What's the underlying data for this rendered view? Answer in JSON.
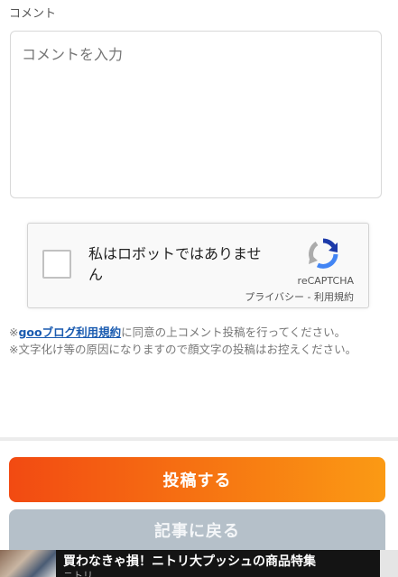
{
  "form": {
    "section_label": "コメント",
    "comment_placeholder": "コメントを入力"
  },
  "recaptcha": {
    "label": "私はロボットではありません",
    "brand": "reCAPTCHA",
    "privacy": "プライバシー",
    "separator": " - ",
    "terms": "利用規約"
  },
  "notes": {
    "line1_prefix": "※",
    "line1_link": "gooブログ利用規約",
    "line1_suffix": "に同意の上コメント投稿を行ってください。",
    "line2": "※文字化け等の原因になりますので顔文字の投稿はお控えください。"
  },
  "buttons": {
    "post": "投稿する",
    "back": "記事に戻る"
  },
  "ad": {
    "title": "買わなきゃ損！ニトリ大プッシュの商品特集",
    "subtitle": "ニトリ"
  },
  "colors": {
    "post_gradient_start": "#f24a12",
    "post_gradient_end": "#fb9a14",
    "back_button": "#b5c0c9",
    "link": "#1a5bb0"
  }
}
